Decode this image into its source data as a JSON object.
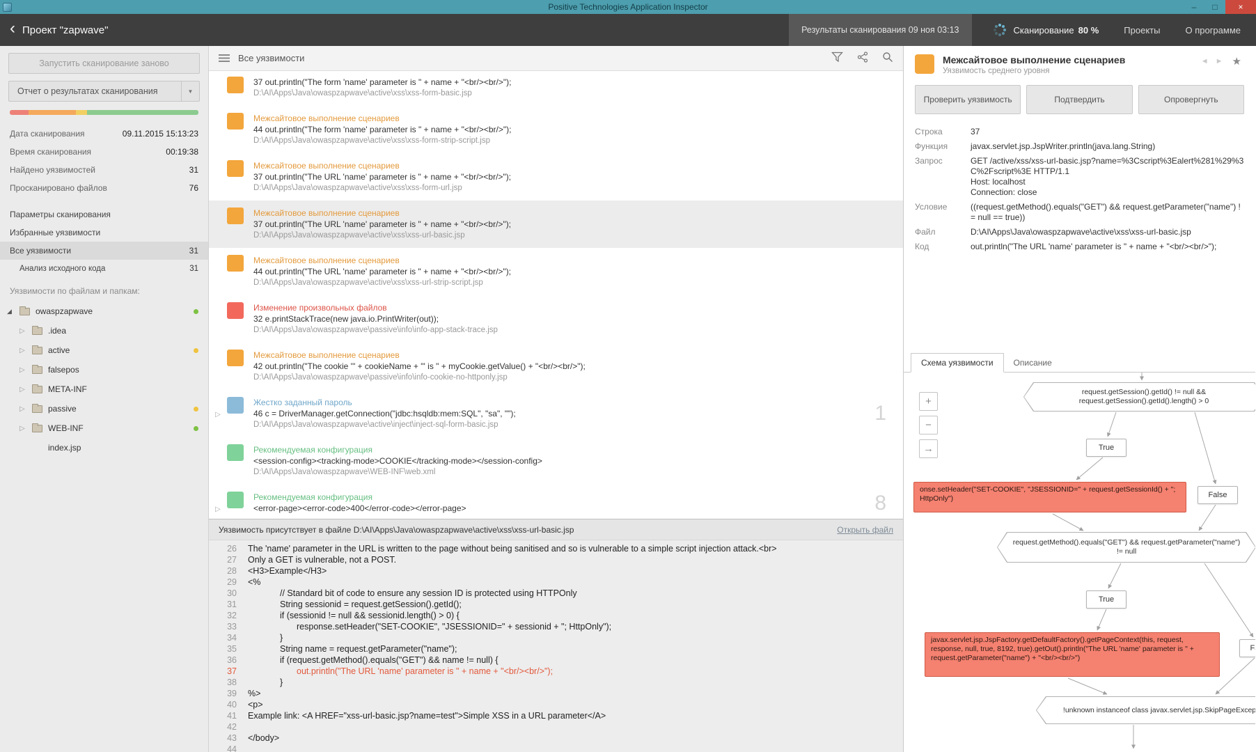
{
  "window": {
    "title": "Positive Technologies Application Inspector",
    "controls": {
      "minimize": "–",
      "maximize": "□",
      "close": "×"
    }
  },
  "header": {
    "back": "‹",
    "project_title": "Проект \"zapwave\"",
    "scan_results": "Результаты сканирования 09 ноя 03:13",
    "scanning_label": "Сканирование",
    "scanning_percent": "80 %",
    "projects": "Проекты",
    "about": "О программе"
  },
  "colors": {
    "titlebar": "#4d9eae",
    "severity_orange": "#f3a63c",
    "severity_red": "#f2695c",
    "severity_blue": "#8cbbd9",
    "severity_green": "#7fd299",
    "diagram_statement": "#f58170"
  },
  "sidebar": {
    "rescan_button": "Запустить сканирование заново",
    "report_button": "Отчет о результатах сканирования",
    "report_caret": "▼",
    "severity_bar": [
      {
        "color": "#ed8178",
        "width": "10%"
      },
      {
        "color": "#f5a95c",
        "width": "25%"
      },
      {
        "color": "#f2cf63",
        "width": "6%"
      },
      {
        "color": "#8ccb8f",
        "width": "59%"
      }
    ],
    "stats": [
      {
        "label": "Дата сканирования",
        "value": "09.11.2015 15:13:23"
      },
      {
        "label": "Время сканирования",
        "value": "00:19:38"
      },
      {
        "label": "Найдено уязвимостей",
        "value": "31"
      },
      {
        "label": "Просканировано файлов",
        "value": "76"
      }
    ],
    "nav": [
      {
        "label": "Параметры сканирования",
        "value": "",
        "state": "",
        "level": "0"
      },
      {
        "label": "Избранные уязвимости",
        "value": "",
        "state": "",
        "level": "0"
      },
      {
        "label": "Все уязвимости",
        "value": "31",
        "state": "selected",
        "level": "0"
      },
      {
        "label": "Анализ исходного кода",
        "value": "31",
        "state": "",
        "level": "1"
      }
    ],
    "tree_header": "Уязвимости по файлам и папкам:",
    "tree": [
      {
        "label": "owaspzapwave",
        "level": "0",
        "expander": "◢",
        "icon": "folder",
        "dot": "#7dc142"
      },
      {
        "label": ".idea",
        "level": "1",
        "expander": "▷",
        "icon": "folder",
        "dot": ""
      },
      {
        "label": "active",
        "level": "1",
        "expander": "▷",
        "icon": "folder",
        "dot": "#f0c33f"
      },
      {
        "label": "falsepos",
        "level": "1",
        "expander": "▷",
        "icon": "folder",
        "dot": ""
      },
      {
        "label": "META-INF",
        "level": "1",
        "expander": "▷",
        "icon": "folder",
        "dot": ""
      },
      {
        "label": "passive",
        "level": "1",
        "expander": "▷",
        "icon": "folder",
        "dot": "#f0c33f"
      },
      {
        "label": "WEB-INF",
        "level": "1",
        "expander": "▷",
        "icon": "folder",
        "dot": "#7dc142"
      },
      {
        "label": "index.jsp",
        "level": "1",
        "expander": "",
        "icon": "none",
        "dot": ""
      }
    ]
  },
  "list": {
    "title": "Все уязвимости",
    "items": [
      {
        "severity": "orange",
        "state": "",
        "expand": "",
        "count": "",
        "title": "",
        "code": "37 out.println(\"The form 'name' parameter is \" + name + \"<br/><br/>\");",
        "path": "D:\\AI\\Apps\\Java\\owaspzapwave\\active\\xss\\xss-form-basic.jsp"
      },
      {
        "severity": "orange",
        "state": "",
        "expand": "",
        "count": "",
        "title": "Межсайтовое выполнение сценариев",
        "code": "44 out.println(\"The form 'name' parameter is \" + name + \"<br/><br/>\");",
        "path": "D:\\AI\\Apps\\Java\\owaspzapwave\\active\\xss\\xss-form-strip-script.jsp"
      },
      {
        "severity": "orange",
        "state": "",
        "expand": "",
        "count": "",
        "title": "Межсайтовое выполнение сценариев",
        "code": "37 out.println(\"The URL 'name' parameter is \" + name + \"<br/><br/>\");",
        "path": "D:\\AI\\Apps\\Java\\owaspzapwave\\active\\xss\\xss-form-url.jsp"
      },
      {
        "severity": "orange",
        "state": "selected",
        "expand": "",
        "count": "",
        "title": "Межсайтовое выполнение сценариев",
        "code": "37 out.println(\"The URL 'name' parameter is \" + name + \"<br/><br/>\");",
        "path": "D:\\AI\\Apps\\Java\\owaspzapwave\\active\\xss\\xss-url-basic.jsp"
      },
      {
        "severity": "orange",
        "state": "",
        "expand": "",
        "count": "",
        "title": "Межсайтовое выполнение сценариев",
        "code": "44 out.println(\"The URL 'name' parameter is \" + name + \"<br/><br/>\");",
        "path": "D:\\AI\\Apps\\Java\\owaspzapwave\\active\\xss\\xss-url-strip-script.jsp"
      },
      {
        "severity": "red",
        "state": "",
        "expand": "",
        "count": "",
        "title": "Изменение произвольных файлов",
        "code": "32 e.printStackTrace(new java.io.PrintWriter(out));",
        "path": "D:\\AI\\Apps\\Java\\owaspzapwave\\passive\\info\\info-app-stack-trace.jsp"
      },
      {
        "severity": "orange",
        "state": "",
        "expand": "",
        "count": "",
        "title": "Межсайтовое выполнение сценариев",
        "code": "42 out.println(\"The cookie '\" + cookieName + \"' is \" + myCookie.getValue() + \"<br/><br/>\");",
        "path": "D:\\AI\\Apps\\Java\\owaspzapwave\\passive\\info\\info-cookie-no-httponly.jsp"
      },
      {
        "severity": "blue",
        "state": "",
        "expand": "▷",
        "count": "1",
        "title": "Жестко заданный пароль",
        "code": "46 c = DriverManager.getConnection(\"jdbc:hsqldb:mem:SQL\", \"sa\", \"\");",
        "path": "D:\\AI\\Apps\\Java\\owaspzapwave\\active\\inject\\inject-sql-form-basic.jsp"
      },
      {
        "severity": "green",
        "state": "",
        "expand": "",
        "count": "",
        "title": "Рекомендуемая конфигурация",
        "code": "<session-config><tracking-mode>COOKIE</tracking-mode></session-config>",
        "path": "D:\\AI\\Apps\\Java\\owaspzapwave\\WEB-INF\\web.xml"
      },
      {
        "severity": "green",
        "state": "",
        "expand": "▷",
        "count": "8",
        "title": "Рекомендуемая конфигурация",
        "code": "<error-page><error-code>400</error-code></error-page>",
        "path": ""
      }
    ]
  },
  "code_panel": {
    "header_text": "Уязвимость присутствует в файле D:\\AI\\Apps\\Java\\owaspzapwave\\active\\xss\\xss-url-basic.jsp",
    "open_file_link": "Открыть файл",
    "lines": [
      {
        "n": "26",
        "ind": "0",
        "hl": "",
        "text": "The 'name' parameter in the URL is written to the page without being sanitised and so is vulnerable to a simple script injection attack.<br>"
      },
      {
        "n": "27",
        "ind": "0",
        "hl": "",
        "text": "Only a GET is vulnerable, not a POST."
      },
      {
        "n": "28",
        "ind": "0",
        "hl": "",
        "text": "<H3>Example</H3>"
      },
      {
        "n": "29",
        "ind": "0",
        "hl": "",
        "text": "<%"
      },
      {
        "n": "30",
        "ind": "1",
        "hl": "",
        "text": "// Standard bit of code to ensure any session ID is protected using HTTPOnly"
      },
      {
        "n": "31",
        "ind": "1",
        "hl": "",
        "text": "String sessionid = request.getSession().getId();"
      },
      {
        "n": "32",
        "ind": "1",
        "hl": "",
        "text": "if (sessionid != null && sessionid.length() > 0) {"
      },
      {
        "n": "33",
        "ind": "2",
        "hl": "",
        "text": "response.setHeader(\"SET-COOKIE\", \"JSESSIONID=\" + sessionid + \"; HttpOnly\");"
      },
      {
        "n": "34",
        "ind": "1",
        "hl": "",
        "text": "}"
      },
      {
        "n": "35",
        "ind": "1",
        "hl": "",
        "text": "String name = request.getParameter(\"name\");"
      },
      {
        "n": "36",
        "ind": "1",
        "hl": "",
        "text": "if (request.getMethod().equals(\"GET\") && name != null) {"
      },
      {
        "n": "37",
        "ind": "2",
        "hl": "on",
        "text": "out.println(\"The URL 'name' parameter is \" + name + \"<br/><br/>\");"
      },
      {
        "n": "38",
        "ind": "1",
        "hl": "",
        "text": "}"
      },
      {
        "n": "39",
        "ind": "0",
        "hl": "",
        "text": "%>"
      },
      {
        "n": "40",
        "ind": "0",
        "hl": "",
        "text": "<p>"
      },
      {
        "n": "41",
        "ind": "0",
        "hl": "",
        "text": "Example link: <A HREF=\"xss-url-basic.jsp?name=test\">Simple XSS in a URL parameter</A>"
      },
      {
        "n": "42",
        "ind": "0",
        "hl": "",
        "text": ""
      },
      {
        "n": "43",
        "ind": "0",
        "hl": "",
        "text": "</body>"
      },
      {
        "n": "44",
        "ind": "0",
        "hl": "",
        "text": ""
      }
    ]
  },
  "details": {
    "title": "Межсайтовое выполнение сценариев",
    "subtitle": "Уязвимость среднего уровня",
    "prev": "◄",
    "next": "►",
    "star": "★",
    "buttons": [
      {
        "label": "Проверить уязвимость"
      },
      {
        "label": "Подтвердить"
      },
      {
        "label": "Опровергнуть"
      }
    ],
    "fields": [
      {
        "label": "Строка",
        "value": "37"
      },
      {
        "label": "Функция",
        "value": "javax.servlet.jsp.JspWriter.println(java.lang.String)"
      },
      {
        "label": "Запрос",
        "value": "GET /active/xss/xss-url-basic.jsp?name=%3Cscript%3Ealert%281%29%3C%2Fscript%3E HTTP/1.1\nHost: localhost\nConnection: close"
      },
      {
        "label": "Условие",
        "value": "((request.getMethod().equals(\"GET\") && request.getParameter(\"name\") != null == true))"
      },
      {
        "label": "Файл",
        "value": "D:\\AI\\Apps\\Java\\owaspzapwave\\active\\xss\\xss-url-basic.jsp"
      },
      {
        "label": "Код",
        "value": "out.println(\"The URL 'name' parameter is \" + name + \"<br/><br/>\");"
      }
    ],
    "tabs": [
      {
        "label": "Схема уязвимости",
        "active": true
      },
      {
        "label": "Описание",
        "active": false
      }
    ]
  },
  "diagram": {
    "zoom_in": "+",
    "zoom_out": "−",
    "pan": "→",
    "nodes": [
      {
        "id": "n1",
        "type": "condition",
        "text": "request.getSession().getId() != null && request.getSession().getId().length() > 0"
      },
      {
        "id": "n2",
        "type": "branch",
        "text": "True"
      },
      {
        "id": "n3",
        "type": "statement",
        "text": "onse.setHeader(\"SET-COOKIE\", \"JSESSIONID=\" + request.getSessionId() + \"; HttpOnly\")"
      },
      {
        "id": "n4",
        "type": "branch",
        "text": "False"
      },
      {
        "id": "n5",
        "type": "condition",
        "text": "request.getMethod().equals(\"GET\") && request.getParameter(\"name\") != null"
      },
      {
        "id": "n6",
        "type": "branch",
        "text": "True"
      },
      {
        "id": "n7",
        "type": "statement",
        "text": "javax.servlet.jsp.JspFactory.getDefaultFactory().getPageContext(this, request, response, null, true, 8192, true).getOut().println(\"The URL 'name' parameter is \" + request.getParameter(\"name\") + \"<br/><br/>\")"
      },
      {
        "id": "n8",
        "type": "branch",
        "text": "False"
      },
      {
        "id": "n9",
        "type": "condition",
        "text": "!unknown instanceof class javax.servlet.jsp.SkipPageException"
      }
    ]
  }
}
